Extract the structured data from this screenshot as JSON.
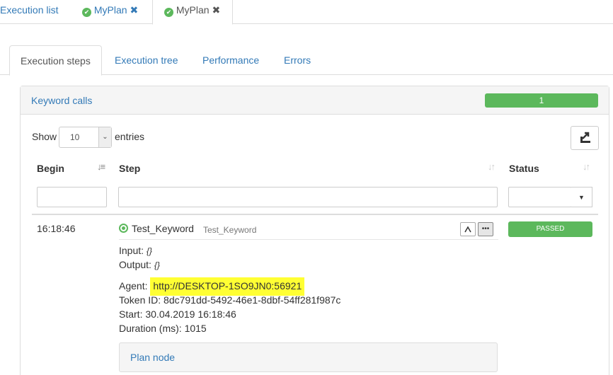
{
  "top_tabs": [
    {
      "label": "Execution list"
    },
    {
      "label": "MyPlan",
      "close": "✖"
    },
    {
      "label": "MyPlan",
      "close": "✖"
    }
  ],
  "sub_tabs": [
    {
      "label": "Execution steps"
    },
    {
      "label": "Execution tree"
    },
    {
      "label": "Performance"
    },
    {
      "label": "Errors"
    }
  ],
  "panel": {
    "title": "Keyword calls",
    "progress_value": "1",
    "show_label": "Show",
    "page_length": "10",
    "entries_label": "entries"
  },
  "table": {
    "headers": {
      "begin": "Begin",
      "step": "Step",
      "status": "Status"
    },
    "row": {
      "begin": "16:18:46",
      "step_name": "Test_Keyword",
      "step_sub": "Test_Keyword",
      "status": "PASSED",
      "input_label": "Input:",
      "input_value": "{}",
      "output_label": "Output:",
      "output_value": "{}",
      "agent_label": "Agent:",
      "agent_value": "http://DESKTOP-1SO9JN0:56921",
      "token_label": "Token ID:",
      "token_value": "8dc791dd-5492-46e1-8dbf-54ff281f987c",
      "start_label": "Start:",
      "start_value": "30.04.2019 16:18:46",
      "duration_label": "Duration (ms):",
      "duration_value": "1015",
      "plan_node_label": "Plan node"
    }
  },
  "colors": {
    "success": "#5cb85c",
    "link": "#337ab7",
    "highlight": "#ffff33"
  }
}
